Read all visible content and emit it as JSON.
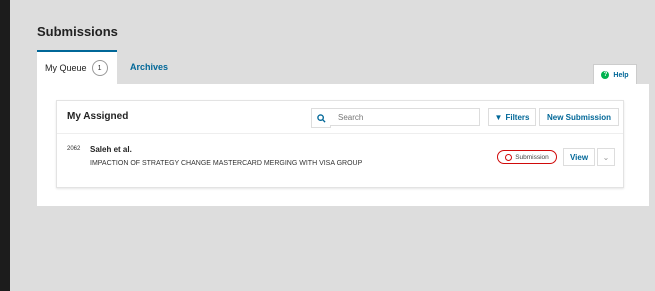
{
  "page": {
    "title": "Submissions"
  },
  "tabs": [
    {
      "label": "My Queue",
      "count": "1"
    },
    {
      "label": "Archives"
    }
  ],
  "help": {
    "label": "Help"
  },
  "list": {
    "title": "My Assigned",
    "search_placeholder": "Search",
    "filters_label": "Filters",
    "new_submission_label": "New Submission",
    "items": [
      {
        "id": "2062",
        "authors": "Saleh et al.",
        "title": "IMPACTION OF STRATEGY CHANGE MASTERCARD MERGING WITH VISA GROUP",
        "status": "Submission",
        "view_label": "View"
      }
    ]
  },
  "colors": {
    "accent": "#006798",
    "status": "#d00a0a",
    "help_icon": "#00b24e"
  }
}
